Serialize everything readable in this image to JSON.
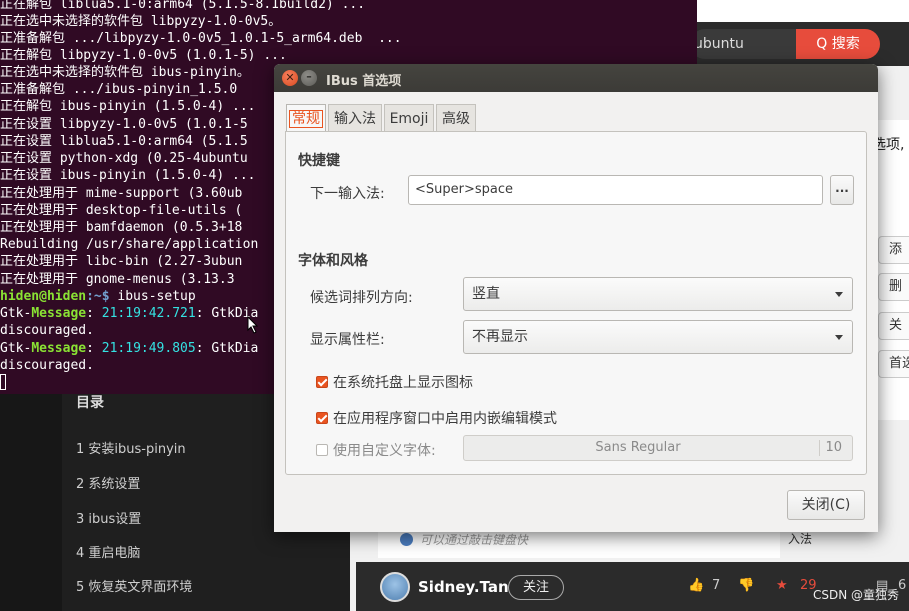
{
  "browser": {
    "search_text": "ubuntu",
    "search_button": "Q 搜索",
    "right_snippet": "选项,",
    "side_buttons": [
      "添",
      "删",
      "关",
      "首选"
    ]
  },
  "toc": {
    "title": "目录",
    "items": [
      "1 安装ibus-pinyin",
      "2 系统设置",
      "3 ibus设置",
      "4 重启电脑",
      "5 恢复英文界面环境"
    ]
  },
  "article_footer": {
    "hint": "可以通过敲击键盘快",
    "right_caption": "入法",
    "author": "Sidney.Tan",
    "follow": "关注",
    "likes": "7",
    "stars": "29",
    "comments": "6",
    "watermark": "CSDN @童独秀"
  },
  "terminal": {
    "lines": [
      "正在解包 liblua5.1-0:arm64 (5.1.5-8.1build2) ...",
      "正在选中未选择的软件包 libpyzy-1.0-0v5。",
      "正准备解包 .../libpyzy-1.0-0v5_1.0.1-5_arm64.deb  ...",
      "正在解包 libpyzy-1.0-0v5 (1.0.1-5) ...",
      "正在选中未选择的软件包 ibus-pinyin。",
      "正准备解包 .../ibus-pinyin_1.5.0",
      "正在解包 ibus-pinyin (1.5.0-4) ...",
      "正在设置 libpyzy-1.0-0v5 (1.0.1-5",
      "正在设置 liblua5.1-0:arm64 (5.1.5",
      "正在设置 python-xdg (0.25-4ubuntu",
      "正在设置 ibus-pinyin (1.5.0-4) ...",
      "正在处理用于 mime-support (3.60ub",
      "正在处理用于 desktop-file-utils (",
      "正在处理用于 bamfdaemon (0.5.3+18",
      "Rebuilding /usr/share/application",
      "正在处理用于 libc-bin (2.27-3ubun",
      "正在处理用于 gnome-menus (3.13.3"
    ],
    "prompt_user": "hiden@hiden",
    "prompt_path": ":~$ ",
    "command": "ibus-setup",
    "msg1_prefix": "Gtk-",
    "msg1_kind": "Message",
    "msg1_time": "21:19:42.721",
    "msg1_rest": ": GtkDia",
    "msg_discouraged": "discouraged.",
    "msg2_time": "21:19:49.805",
    "msg2_rest": ": GtkDia"
  },
  "dialog": {
    "title": "IBus 首选项",
    "close_glyph": "✕",
    "min_glyph": "–",
    "tabs": [
      "常规",
      "输入法",
      "Emoji",
      "高级"
    ],
    "shortcuts": {
      "section": "快捷键",
      "next_input_label": "下一输入法:",
      "next_input_value": "<Super>space",
      "dots": "..."
    },
    "fonts_style": {
      "section": "字体和风格",
      "orientation_label": "候选词排列方向:",
      "orientation_value": "竖直",
      "show_panel_label": "显示属性栏:",
      "show_panel_value": "不再显示",
      "tray_icon": "在系统托盘上显示图标",
      "embed_preedit": "在应用程序窗口中启用内嵌编辑模式",
      "custom_font": "使用自定义字体:",
      "font_name": "Sans Regular",
      "font_size": "10"
    },
    "close_button": "关闭(C)"
  },
  "colors": {
    "accent": "#e95420",
    "terminal_bg": "#300a24",
    "search_button": "#e74c3c"
  }
}
